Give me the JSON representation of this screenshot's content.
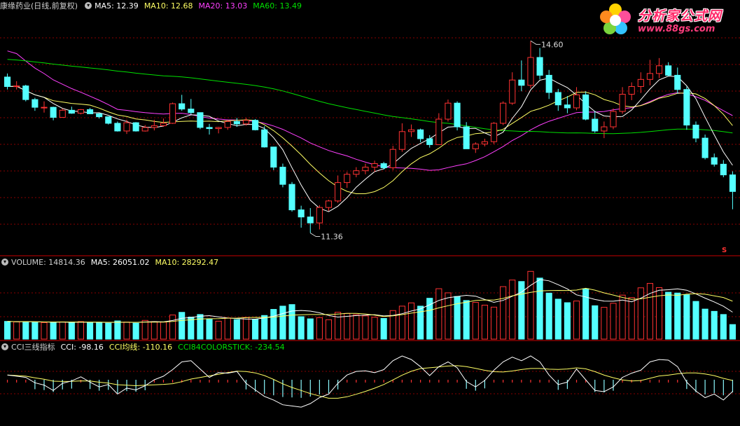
{
  "price_panel": {
    "title": "康缘药业(日线,前复权)",
    "ma5": "MA5: 12.39",
    "ma10": "MA10: 12.68",
    "ma20": "MA20: 13.03",
    "ma60": "MA60: 13.49",
    "high_label": "14.60",
    "low_label": "11.36",
    "s_marker": "S"
  },
  "volume_panel": {
    "volume": "VOLUME: 14814.36",
    "ma5": "MA5: 26051.02",
    "ma10": "MA10: 28292.47"
  },
  "cci_panel": {
    "title": "CCI三线指标",
    "cci": "CCI: -98.16",
    "cci_avg": "CCI均线: -110.16",
    "cci84": "CCI84COLORSTICK: -234.54"
  },
  "logo": {
    "main": "分析家公式网",
    "sub": "www.88gs.com"
  },
  "colors": {
    "up": "#ff3232",
    "down": "#54ffff",
    "ma5": "#ffffff",
    "ma10": "#ffff64",
    "ma20": "#ff40ff",
    "ma60": "#00e000",
    "grid": "#8a0000",
    "separator": "#c80000"
  },
  "chart_data": {
    "type": "candlestick",
    "ylim": [
      11.0,
      15.1
    ],
    "price_high": 14.6,
    "price_low": 11.36,
    "candles": [
      [
        13.99,
        14.05,
        13.78,
        13.83
      ],
      [
        13.83,
        13.92,
        13.78,
        13.84
      ],
      [
        13.84,
        13.86,
        13.58,
        13.61
      ],
      [
        13.61,
        13.64,
        13.42,
        13.48
      ],
      [
        13.48,
        13.58,
        13.39,
        13.48
      ],
      [
        13.48,
        13.49,
        13.26,
        13.31
      ],
      [
        13.31,
        13.46,
        13.31,
        13.43
      ],
      [
        13.43,
        13.49,
        13.37,
        13.38
      ],
      [
        13.38,
        13.45,
        13.36,
        13.44
      ],
      [
        13.44,
        13.47,
        13.37,
        13.37
      ],
      [
        13.37,
        13.38,
        13.29,
        13.32
      ],
      [
        13.32,
        13.32,
        13.19,
        13.21
      ],
      [
        13.21,
        13.24,
        13.07,
        13.08
      ],
      [
        13.08,
        13.27,
        13.03,
        13.22
      ],
      [
        13.22,
        13.23,
        13.07,
        13.08
      ],
      [
        13.08,
        13.18,
        13.07,
        13.14
      ],
      [
        13.14,
        13.27,
        13.09,
        13.17
      ],
      [
        13.17,
        13.29,
        13.15,
        13.21
      ],
      [
        13.21,
        13.56,
        13.2,
        13.54
      ],
      [
        13.54,
        13.69,
        13.42,
        13.45
      ],
      [
        13.45,
        13.62,
        13.36,
        13.39
      ],
      [
        13.39,
        13.39,
        13.11,
        13.14
      ],
      [
        13.14,
        13.2,
        13.02,
        13.12
      ],
      [
        13.12,
        13.15,
        13.04,
        13.14
      ],
      [
        13.14,
        13.26,
        13.1,
        13.24
      ],
      [
        13.24,
        13.3,
        13.15,
        13.2
      ],
      [
        13.2,
        13.3,
        13.17,
        13.26
      ],
      [
        13.26,
        13.28,
        13.09,
        13.1
      ],
      [
        13.1,
        13.16,
        12.8,
        12.81
      ],
      [
        12.81,
        12.81,
        12.42,
        12.47
      ],
      [
        12.47,
        12.53,
        12.13,
        12.18
      ],
      [
        12.18,
        12.22,
        11.72,
        11.75
      ],
      [
        11.75,
        11.82,
        11.45,
        11.63
      ],
      [
        11.63,
        11.78,
        11.36,
        11.53
      ],
      [
        11.53,
        11.83,
        11.42,
        11.79
      ],
      [
        11.79,
        11.92,
        11.73,
        11.9
      ],
      [
        11.9,
        12.33,
        11.87,
        12.21
      ],
      [
        12.21,
        12.39,
        12.12,
        12.35
      ],
      [
        12.35,
        12.47,
        12.3,
        12.41
      ],
      [
        12.41,
        12.53,
        12.35,
        12.47
      ],
      [
        12.47,
        12.58,
        12.39,
        12.53
      ],
      [
        12.53,
        12.56,
        12.43,
        12.46
      ],
      [
        12.46,
        12.83,
        12.42,
        12.77
      ],
      [
        12.77,
        13.21,
        12.73,
        13.07
      ],
      [
        13.07,
        13.19,
        12.98,
        13.1
      ],
      [
        13.1,
        13.12,
        12.89,
        12.95
      ],
      [
        12.95,
        13.01,
        12.8,
        12.85
      ],
      [
        12.85,
        13.38,
        12.85,
        13.28
      ],
      [
        13.28,
        13.61,
        13.24,
        13.55
      ],
      [
        13.55,
        13.58,
        13.09,
        13.15
      ],
      [
        13.15,
        13.23,
        12.78,
        12.78
      ],
      [
        12.78,
        12.89,
        12.71,
        12.86
      ],
      [
        12.86,
        12.95,
        12.82,
        12.9
      ],
      [
        12.9,
        13.23,
        12.86,
        13.21
      ],
      [
        13.21,
        13.58,
        13.18,
        13.55
      ],
      [
        13.55,
        14.07,
        13.52,
        13.94
      ],
      [
        13.94,
        14.27,
        13.75,
        13.85
      ],
      [
        13.85,
        14.6,
        13.8,
        14.32
      ],
      [
        14.32,
        14.48,
        13.95,
        14.02
      ],
      [
        14.02,
        14.11,
        13.62,
        13.73
      ],
      [
        13.73,
        13.79,
        13.42,
        13.52
      ],
      [
        13.52,
        13.67,
        13.38,
        13.47
      ],
      [
        13.47,
        13.82,
        13.43,
        13.69
      ],
      [
        13.69,
        13.75,
        13.26,
        13.28
      ],
      [
        13.28,
        13.42,
        13.05,
        13.08
      ],
      [
        13.08,
        13.24,
        12.96,
        13.15
      ],
      [
        13.15,
        13.46,
        13.11,
        13.41
      ],
      [
        13.41,
        13.82,
        13.37,
        13.7
      ],
      [
        13.7,
        13.9,
        13.6,
        13.83
      ],
      [
        13.83,
        14.07,
        13.72,
        13.95
      ],
      [
        13.95,
        14.28,
        13.85,
        14.05
      ],
      [
        14.05,
        14.31,
        13.97,
        14.18
      ],
      [
        14.18,
        14.24,
        14.0,
        14.02
      ],
      [
        14.02,
        14.15,
        13.71,
        13.78
      ],
      [
        13.78,
        13.83,
        13.1,
        13.18
      ],
      [
        13.18,
        13.24,
        12.89,
        12.96
      ],
      [
        12.96,
        13.02,
        12.6,
        12.63
      ],
      [
        12.63,
        12.7,
        12.48,
        12.52
      ],
      [
        12.52,
        12.59,
        12.3,
        12.34
      ],
      [
        12.34,
        12.4,
        11.76,
        12.06
      ]
    ],
    "volume": [
      18000,
      17500,
      17800,
      17200,
      16800,
      17000,
      17500,
      16900,
      17800,
      16600,
      16800,
      16200,
      18500,
      17300,
      16200,
      19000,
      17800,
      17300,
      24500,
      27200,
      22400,
      25000,
      20100,
      18200,
      21500,
      19800,
      22000,
      20000,
      24000,
      30200,
      33500,
      35100,
      22800,
      20600,
      21800,
      19700,
      27300,
      26100,
      24800,
      23600,
      22200,
      21000,
      29000,
      33500,
      36800,
      33500,
      41500,
      51200,
      47000,
      43300,
      39200,
      37300,
      34500,
      32500,
      53300,
      60000,
      58500,
      68800,
      62000,
      46700,
      40600,
      37000,
      38700,
      51200,
      33900,
      32300,
      36400,
      44700,
      42200,
      52100,
      56600,
      52300,
      47600,
      46800,
      45000,
      38300,
      30500,
      28200,
      25000,
      14800
    ],
    "cci": [
      40,
      30,
      20,
      -25,
      -45,
      -90,
      -30,
      -10,
      25,
      -20,
      -60,
      -40,
      -120,
      -70,
      -85,
      -50,
      0,
      30,
      85,
      150,
      160,
      90,
      20,
      60,
      55,
      70,
      -30,
      -85,
      -140,
      -170,
      -210,
      -220,
      -230,
      -200,
      -150,
      -120,
      -30,
      40,
      70,
      75,
      60,
      85,
      160,
      200,
      170,
      110,
      35,
      110,
      150,
      100,
      -15,
      -60,
      -5,
      80,
      150,
      190,
      160,
      200,
      150,
      40,
      -40,
      -20,
      90,
      0,
      -90,
      -100,
      -60,
      20,
      55,
      80,
      150,
      170,
      165,
      110,
      -20,
      -95,
      -150,
      -120,
      -170,
      -98.16
    ],
    "cci_avg_last": -110.16,
    "cci84_last": -234.54,
    "legend": [
      "MA5",
      "MA10",
      "MA20",
      "MA60"
    ]
  }
}
